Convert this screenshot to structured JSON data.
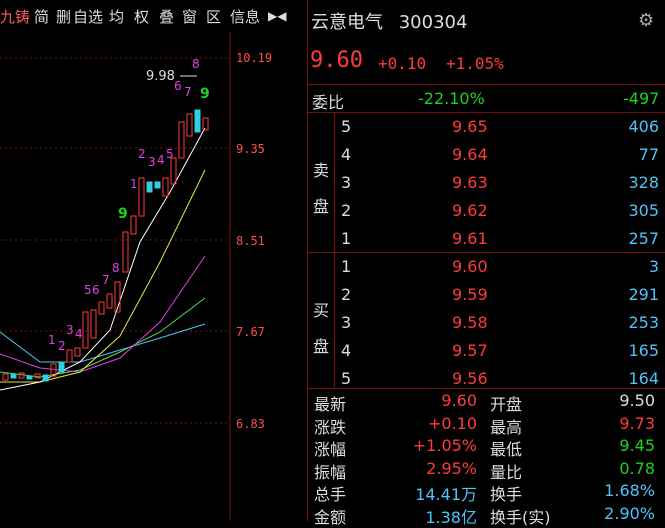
{
  "toolbar": {
    "stock_short": "九铸",
    "items": [
      "简",
      "删",
      "自选",
      "均",
      "权",
      "叠",
      "窗",
      "区",
      "信息"
    ],
    "arrow": "▶◀"
  },
  "chart": {
    "price_levels": [
      "10.19",
      "9.35",
      "8.51",
      "7.67",
      "6.83"
    ],
    "peak_label": "9.98",
    "colors": {
      "up": "#ff3b3b",
      "down": "#2fd0e0",
      "ma5": "#ffffff",
      "ma10": "#e6e64a",
      "ma20": "#e040e0",
      "ma30": "#55dd55",
      "ma60": "#4fc3f7",
      "grid": "#7a1010"
    }
  },
  "quote": {
    "name": "云意电气",
    "code": "300304",
    "last": "9.60",
    "change": "+0.10",
    "pct": "+1.05%"
  },
  "weibi": {
    "label": "委比",
    "pct": "-22.10%",
    "diff": "-497"
  },
  "sell_label": "卖盘",
  "buy_label": "买盘",
  "sell": [
    {
      "lvl": "5",
      "price": "9.65",
      "vol": "406"
    },
    {
      "lvl": "4",
      "price": "9.64",
      "vol": "77"
    },
    {
      "lvl": "3",
      "price": "9.63",
      "vol": "328"
    },
    {
      "lvl": "2",
      "price": "9.62",
      "vol": "305"
    },
    {
      "lvl": "1",
      "price": "9.61",
      "vol": "257"
    }
  ],
  "buy": [
    {
      "lvl": "1",
      "price": "9.60",
      "vol": "3"
    },
    {
      "lvl": "2",
      "price": "9.59",
      "vol": "291"
    },
    {
      "lvl": "3",
      "price": "9.58",
      "vol": "253"
    },
    {
      "lvl": "4",
      "price": "9.57",
      "vol": "165"
    },
    {
      "lvl": "5",
      "price": "9.56",
      "vol": "164"
    }
  ],
  "stats": [
    {
      "l1": "最新",
      "v1": "9.60",
      "c1": "r",
      "l2": "开盘",
      "v2": "9.50",
      "c2": "w"
    },
    {
      "l1": "涨跌",
      "v1": "+0.10",
      "c1": "r",
      "l2": "最高",
      "v2": "9.73",
      "c2": "r"
    },
    {
      "l1": "涨幅",
      "v1": "+1.05%",
      "c1": "r",
      "l2": "最低",
      "v2": "9.45",
      "c2": "g"
    },
    {
      "l1": "振幅",
      "v1": "2.95%",
      "c1": "r",
      "l2": "量比",
      "v2": "0.78",
      "c2": "g"
    },
    {
      "l1": "总手",
      "v1": "14.41万",
      "c1": "c",
      "l2": "换手",
      "v2": "1.68%",
      "c2": "c"
    },
    {
      "l1": "金额",
      "v1": "1.38亿",
      "c1": "c",
      "l2": "换手(实)",
      "v2": "2.90%",
      "c2": "c"
    }
  ]
}
